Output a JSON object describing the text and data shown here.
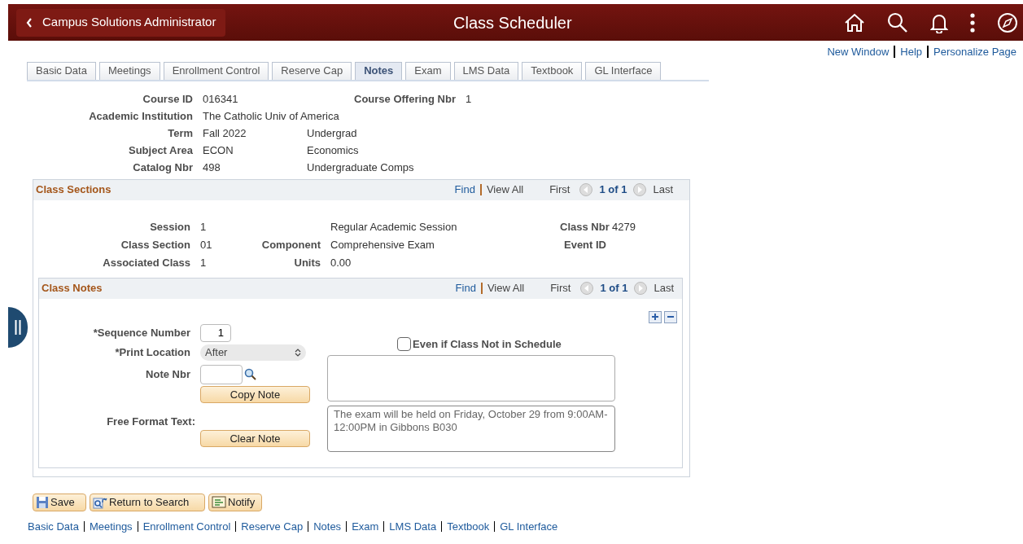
{
  "header": {
    "back_label": "Campus Solutions Administrator",
    "title": "Class Scheduler"
  },
  "top_links": [
    "New Window",
    "Help",
    "Personalize Page"
  ],
  "tabs": [
    {
      "label": "Basic Data",
      "selected": false
    },
    {
      "label": "Meetings",
      "selected": false
    },
    {
      "label": "Enrollment Control",
      "selected": false
    },
    {
      "label": "Reserve Cap",
      "selected": false
    },
    {
      "label": "Notes",
      "selected": true
    },
    {
      "label": "Exam",
      "selected": false
    },
    {
      "label": "LMS Data",
      "selected": false
    },
    {
      "label": "Textbook",
      "selected": false
    },
    {
      "label": "GL Interface",
      "selected": false
    }
  ],
  "course": {
    "course_id_label": "Course ID",
    "course_id": "016341",
    "offering_label": "Course Offering Nbr",
    "offering": "1",
    "rows": [
      {
        "label": "Academic Institution",
        "value": "The Catholic Univ of America",
        "extra": ""
      },
      {
        "label": "Term",
        "value": "Fall 2022",
        "extra": "Undergrad"
      },
      {
        "label": "Subject Area",
        "value": "ECON",
        "extra": "Economics"
      },
      {
        "label": "Catalog Nbr",
        "value": "498",
        "extra": "Undergraduate Comps"
      }
    ]
  },
  "class_sections": {
    "title": "Class Sections",
    "find": "Find",
    "view_all": "View All",
    "first": "First",
    "count": "1 of 1",
    "last": "Last",
    "session_label": "Session",
    "session": "1",
    "session_desc": "Regular Academic Session",
    "class_nbr_label": "Class Nbr",
    "class_nbr": "4279",
    "section_label": "Class Section",
    "section": "01",
    "component_label": "Component",
    "component": "Comprehensive Exam",
    "event_id_label": "Event ID",
    "assoc_label": "Associated Class",
    "assoc": "1",
    "units_label": "Units",
    "units": "0.00"
  },
  "class_notes": {
    "title": "Class Notes",
    "find": "Find",
    "view_all": "View All",
    "first": "First",
    "count": "1 of 1",
    "last": "Last",
    "seq_label": "*Sequence Number",
    "seq": "1",
    "print_label": "*Print Location",
    "print_value": "After",
    "even_if_label": "Even if Class Not in Schedule",
    "even_if_checked": false,
    "note_nbr_label": "Note Nbr",
    "copy_note": "Copy Note",
    "free_label": "Free Format Text:",
    "clear_note": "Clear Note",
    "free_text": "The exam will be held on Friday, October 29 from 9:00AM-12:00PM in Gibbons B030"
  },
  "buttons": [
    "Save",
    "Return to Search",
    "Notify"
  ],
  "bottom_links": [
    "Basic Data",
    "Meetings",
    "Enrollment Control",
    "Reserve Cap",
    "Notes",
    "Exam",
    "LMS Data",
    "Textbook",
    "GL Interface"
  ]
}
